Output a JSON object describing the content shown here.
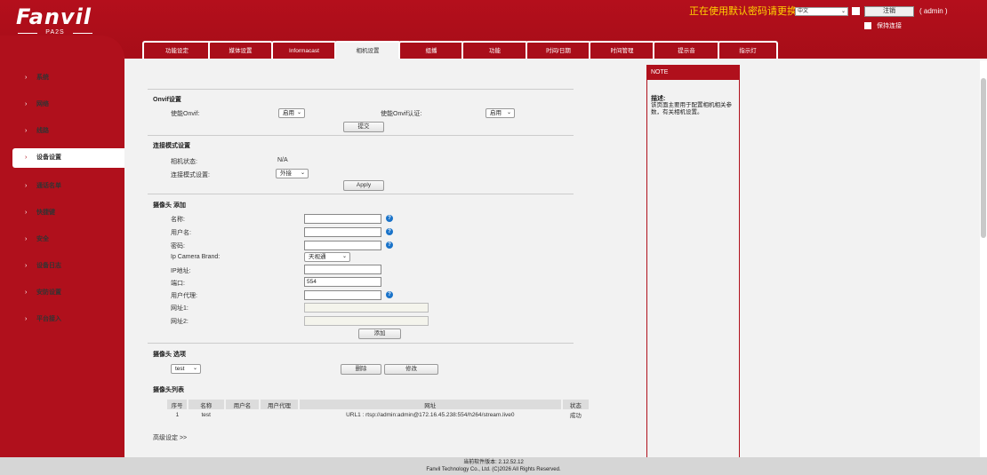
{
  "header": {
    "logo_brand": "Fanvil",
    "logo_model": "PA2S",
    "warning": "正在使用默认密码请更换",
    "language": "中文",
    "logout_label": "注销",
    "user": "( admin )",
    "keep_login": "保持连接"
  },
  "sidebar": {
    "items": [
      {
        "label": "系统"
      },
      {
        "label": "网络"
      },
      {
        "label": "线路"
      },
      {
        "label": "设备设置"
      },
      {
        "label": "通话名单"
      },
      {
        "label": "快捷键"
      },
      {
        "label": "安全"
      },
      {
        "label": "设备日志"
      },
      {
        "label": "安防设置"
      },
      {
        "label": "平台接入"
      }
    ],
    "active_index": 3
  },
  "tabs": [
    {
      "label": "功能设定"
    },
    {
      "label": "媒体设置"
    },
    {
      "label": "Informacast"
    },
    {
      "label": "相机设置"
    },
    {
      "label": "组播"
    },
    {
      "label": "功能"
    },
    {
      "label": "时间/日期"
    },
    {
      "label": "时间管理"
    },
    {
      "label": "提示音"
    },
    {
      "label": "指示灯"
    }
  ],
  "onvif": {
    "title": "Onvif设置",
    "enable_label": "使能Onvif:",
    "enable_value": "启用",
    "auth_label": "使能Onvif认证:",
    "auth_value": "启用",
    "submit_label": "提交"
  },
  "connect": {
    "title": "连接模式设置",
    "status_label": "相机状态:",
    "status_value": "N/A",
    "mode_label": "连接模式设置:",
    "mode_value": "外接",
    "apply_label": "Apply"
  },
  "add": {
    "title": "摄像头 添加",
    "name_label": "名称:",
    "user_label": "用户名:",
    "password_label": "密码:",
    "brand_label": "Ip Camera Brand:",
    "brand_value": "天视通",
    "ip_label": "IP地址:",
    "port_label": "端口:",
    "port_value": "554",
    "agent_label": "用户代理:",
    "url1_label": "网址1:",
    "url2_label": "网址2:",
    "add_label": "添加"
  },
  "options": {
    "title": "摄像头 选项",
    "select_value": "test",
    "delete_label": "删除",
    "edit_label": "修改"
  },
  "list": {
    "title": "摄像头列表",
    "headers": [
      "序号",
      "名称",
      "用户名",
      "用户代理",
      "网址",
      "状态"
    ],
    "rows": [
      [
        "1",
        "test",
        "",
        "",
        "URL1 : rtsp://admin:admin@172.16.45.238:554/h264/stream.live0",
        "成功"
      ]
    ]
  },
  "advanced_label": "高级设定 >>",
  "note": {
    "head": "NOTE",
    "title": "描述:",
    "text": "该页面主要用于配置相机相关参数，有关相机设置。"
  },
  "footer": {
    "version": "当前软件版本: 2.12.52.12",
    "copyright": "Fanvil Technology Co., Ltd. (C)2026 All Rights Reserved."
  }
}
